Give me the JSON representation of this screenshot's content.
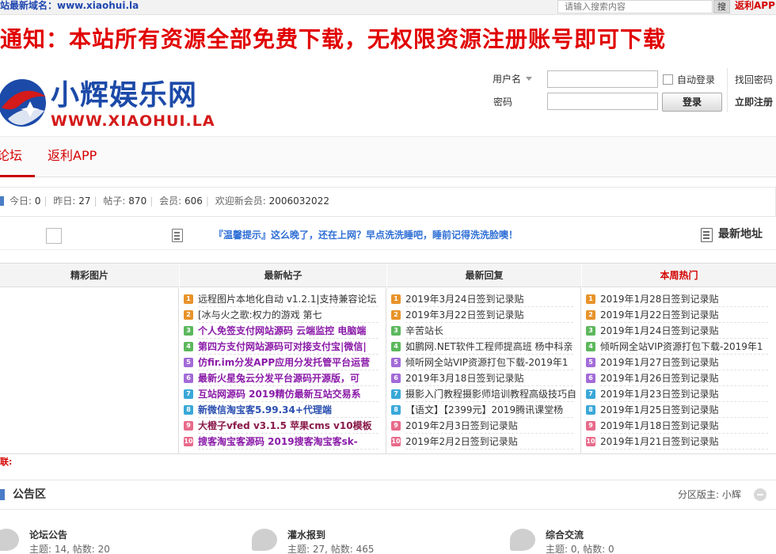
{
  "topbar": {
    "domain_text": "站最新域名：www.xiaohui.la",
    "search_placeholder": "请输入搜索内容",
    "search_button": "搜",
    "app_link": "返利APP"
  },
  "notice": "通知：本站所有资源全部免费下载，无权限资源注册账号即可下载",
  "logo": {
    "name_cn": "小辉娱乐网",
    "name_en": "WWW.XIAOHUI.LA"
  },
  "login": {
    "username_label": "用户名",
    "password_label": "密码",
    "auto_login": "自动登录",
    "login_button": "登录",
    "forgot_password": "找回密码",
    "register": "立即注册"
  },
  "nav": {
    "tabs": [
      "论坛",
      "返利APP"
    ],
    "active": 0
  },
  "stats": {
    "today_label": "今日:",
    "today": "0",
    "yesterday_label": "昨日:",
    "yesterday": "27",
    "posts_label": "帖子:",
    "posts": "870",
    "members_label": "会员:",
    "members": "606",
    "welcome_label": "欢迎新会员:",
    "newest_member": "2006032022"
  },
  "tips": {
    "text": "『温馨提示』这么晚了，还在上网？早点洗洗睡吧，睡前记得洗洗脸噢！",
    "latest_address": "最新地址"
  },
  "grid": {
    "headers": [
      "精彩图片",
      "最新帖子",
      "最新回复",
      "本周热门"
    ],
    "latest_posts": [
      "远程图片本地化自动 v1.2.1|支持兼容论坛",
      "[冰与火之歌:权力的游戏 第七",
      "个人免签支付网站源码 云端监控 电脑端",
      "第四方支付网站源码可对接支付宝|微信|",
      "仿fir.im分发APP应用分发托管平台运营",
      "最新火星兔云分发平台源码开源版，可",
      "互站网源码 2019精仿最新互站交易系",
      "新微信淘宝客5.99.34+代理端",
      "大橙子vfed v3.1.5 苹果cms v10模板",
      "搜客淘宝客源码 2019搜客淘宝客sk-"
    ],
    "latest_replies": [
      "2019年3月24日签到记录贴",
      "2019年3月22日签到记录贴",
      "辛苦站长",
      "如鹏网.NET软件工程师提高班 杨中科亲",
      "倾听网全站VIP资源打包下载-2019年1",
      "2019年3月18日签到记录贴",
      "摄影入门教程摄影师培训教程高级技巧自",
      "【语文】【2399元】2019腾讯课堂杨",
      "2019年2月3日签到记录贴",
      "2019年2月2日签到记录贴"
    ],
    "weekly_hot": [
      "2019年1月28日签到记录贴",
      "2019年1月22日签到记录贴",
      "2019年1月24日签到记录贴",
      "倾听网全站VIP资源打包下载-2019年1",
      "2019年1月27日签到记录贴",
      "2019年1月26日签到记录贴",
      "2019年1月23日签到记录贴",
      "2019年1月25日签到记录贴",
      "2019年1月18日签到记录贴",
      "2019年1月21日签到记录贴"
    ],
    "rank_numbers": [
      "1",
      "2",
      "3",
      "4",
      "5",
      "6",
      "7",
      "8",
      "9",
      "10"
    ]
  },
  "friend_links_label": "联:",
  "section": {
    "title": "公告区",
    "moderator": "分区版主: 小辉",
    "forums": [
      {
        "name": "论坛公告",
        "stats": "主题: 14, 帖数: 20"
      },
      {
        "name": "灌水报到",
        "stats": "主题: 27, 帖数: 465"
      },
      {
        "name": "综合交流",
        "stats": "主题: 0, 帖数: 0"
      }
    ]
  },
  "colors": {
    "brand_blue": "#1c4aa8",
    "brand_red": "#d41a1a",
    "notice_red": "#e10000",
    "tip_blue": "#2f6fd6",
    "rank_colors": [
      "#e8932a",
      "#e8932a",
      "#5cb85c",
      "#5cb85c",
      "#a36bd8",
      "#a36bd8",
      "#3aa8d8",
      "#3aa8d8",
      "#e86a8a",
      "#e86a8a"
    ]
  }
}
